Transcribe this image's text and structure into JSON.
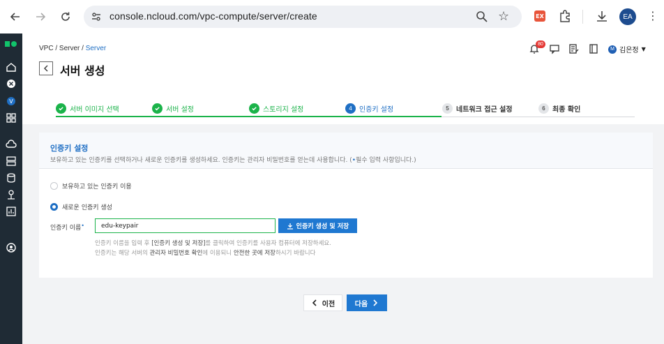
{
  "browser": {
    "url": "console.ncloud.com/vpc-compute/server/create",
    "profile_initials": "EA",
    "ext_label": "EX"
  },
  "header": {
    "breadcrumb": [
      "VPC",
      "Server",
      "Server"
    ],
    "breadcrumb_sep": "/",
    "title": "서버 생성",
    "notification_count": "80",
    "user_initial": "M",
    "user_name": "김은정"
  },
  "stepper": {
    "steps": [
      {
        "label": "서버 이미지 선택",
        "state": "done"
      },
      {
        "label": "서버 설정",
        "state": "done"
      },
      {
        "label": "스토리지 설정",
        "state": "done"
      },
      {
        "label": "인증키 설정",
        "state": "active",
        "num": "4"
      },
      {
        "label": "네트워크 접근 설정",
        "state": "todo",
        "num": "5"
      },
      {
        "label": "최종 확인",
        "state": "todo",
        "num": "6"
      }
    ]
  },
  "card": {
    "title": "인증키 설정",
    "desc": "보유하고 있는 인증키를 선택하거나 새로운 인증키를 생성하세요. 인증키는 관리자 비밀번호를 얻는데 사용합니다. (",
    "desc_req_mark": "•",
    "desc_tail": "필수 입력 사항입니다.)",
    "option_existing": "보유하고 있는 인증키 이용",
    "option_new": "새로운 인증키 생성",
    "field_label": "인증키 이름",
    "field_req": "•",
    "key_name_value": "edu-keypair",
    "generate_button": "인증키 생성 및 저장",
    "help1_a": "인증키 이름을 입력 후 ",
    "help1_b": "[인증키 생성 및 저장]",
    "help1_c": "를 클릭하여 인증키를 사용자 컴퓨터에 저장하세요.",
    "help2_a": "인증키는 해당 서버의 ",
    "help2_b": "관리자 비밀번호 확인",
    "help2_c": "에 이용되니 ",
    "help2_d": "안전한 곳에 저장",
    "help2_e": "하시기 바랍니다"
  },
  "footer": {
    "prev_label": "이전",
    "next_label": "다음"
  },
  "colors": {
    "accent": "#1f78d1",
    "done": "#1bb34a",
    "sidebar": "#1f2b35"
  }
}
